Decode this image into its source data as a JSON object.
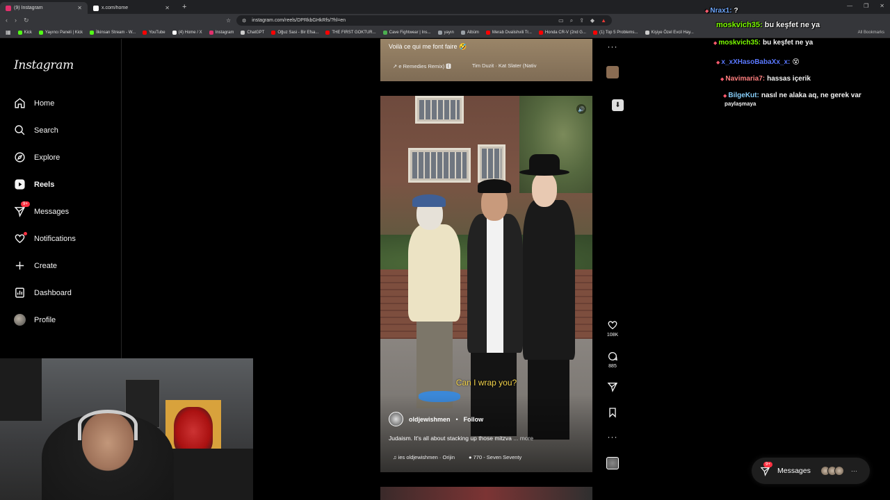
{
  "browser": {
    "tabs": [
      {
        "title": "(9) Instagram",
        "fav_color": "#e1306c",
        "active": true
      },
      {
        "title": "x.com/home",
        "fav_color": "#ffffff",
        "active": false
      }
    ],
    "url": "instagram.com/reels/DPRkbGHkRfs/?hl=en",
    "bookmarks": [
      {
        "label": "Kick",
        "color": "#53fc18"
      },
      {
        "label": "Yayıncı Paneli | Kick",
        "color": "#53fc18"
      },
      {
        "label": "İlkinsan Stream - W...",
        "color": "#53fc18"
      },
      {
        "label": "YouTube",
        "color": "#ff0000"
      },
      {
        "label": "(4) Home / X",
        "color": "#ffffff"
      },
      {
        "label": "Instagram",
        "color": "#e1306c"
      },
      {
        "label": "ChatGPT",
        "color": "#cccccc"
      },
      {
        "label": "Oğuz Sasi - Bir Efsa...",
        "color": "#ff0000"
      },
      {
        "label": "THE FIRST GOKTUR...",
        "color": "#ff0000"
      },
      {
        "label": "Cave Fightwear | Ins...",
        "color": "#4caf50"
      },
      {
        "label": "yayın",
        "color": "#9aa0a6"
      },
      {
        "label": "Albüm",
        "color": "#9aa0a6"
      },
      {
        "label": "Merab Dvalishvili Tr...",
        "color": "#ff0000"
      },
      {
        "label": "Honda CR-V (2nd G...",
        "color": "#ff0000"
      },
      {
        "label": "(1) Top 5 Problems...",
        "color": "#ff0000"
      },
      {
        "label": "Kişiye Özel Evcil Hay...",
        "color": "#cccccc"
      }
    ],
    "all_bookmarks": "All Bookmarks"
  },
  "sidebar": {
    "logo": "Instagram",
    "items": [
      {
        "label": "Home",
        "icon": "home-icon"
      },
      {
        "label": "Search",
        "icon": "search-icon"
      },
      {
        "label": "Explore",
        "icon": "compass-icon"
      },
      {
        "label": "Reels",
        "icon": "reels-icon"
      },
      {
        "label": "Messages",
        "icon": "messenger-icon",
        "badge": "9+"
      },
      {
        "label": "Notifications",
        "icon": "heart-icon"
      },
      {
        "label": "Create",
        "icon": "plus-icon"
      },
      {
        "label": "Dashboard",
        "icon": "dashboard-icon"
      },
      {
        "label": "Profile",
        "icon": "avatar"
      }
    ]
  },
  "prev_reel": {
    "caption": "Voilà ce qui me font faire 🤣",
    "audio_left": "↗ e Remedies Remix) 🅴",
    "audio_right": "Tim Duzit · Kat Slater (Nativ"
  },
  "reel": {
    "subtitle": "Can I wrap you?",
    "owner": "oldjewishmen",
    "follow": "Follow",
    "dot": "•",
    "caption": "Judaism. It's all about stacking up those mitzva",
    "more": "... more",
    "audio": "♫ ies oldjewishmen · Orijin",
    "location": "● 770 - Seven Seventy",
    "likes": "108K",
    "comments": "885"
  },
  "chat": [
    {
      "user": "Nrax1:",
      "text": "?",
      "color": "#6fa8ff"
    },
    {
      "user": "moskvich35:",
      "text": "bu keşfet ne ya",
      "color": "#7cfc00"
    },
    {
      "user": "moskvich35:",
      "text": "bu keşfet ne ya",
      "color": "#7cfc00"
    },
    {
      "user": "x_xXHasoBabaXx_x:",
      "text": "😵",
      "color": "#5a78ff"
    },
    {
      "user": "Navimaria7:",
      "text": "hassas içerik",
      "color": "#ff7f7f"
    },
    {
      "user": "BilgeKut:",
      "text": "nasıl ne alaka aq, ne gerek var",
      "color": "#87cefa"
    },
    {
      "user": "",
      "text": "paylaşmaya",
      "color": "#ffffff"
    }
  ],
  "messages_pill": {
    "label": "Messages",
    "badge": "9+",
    "more": "···"
  }
}
